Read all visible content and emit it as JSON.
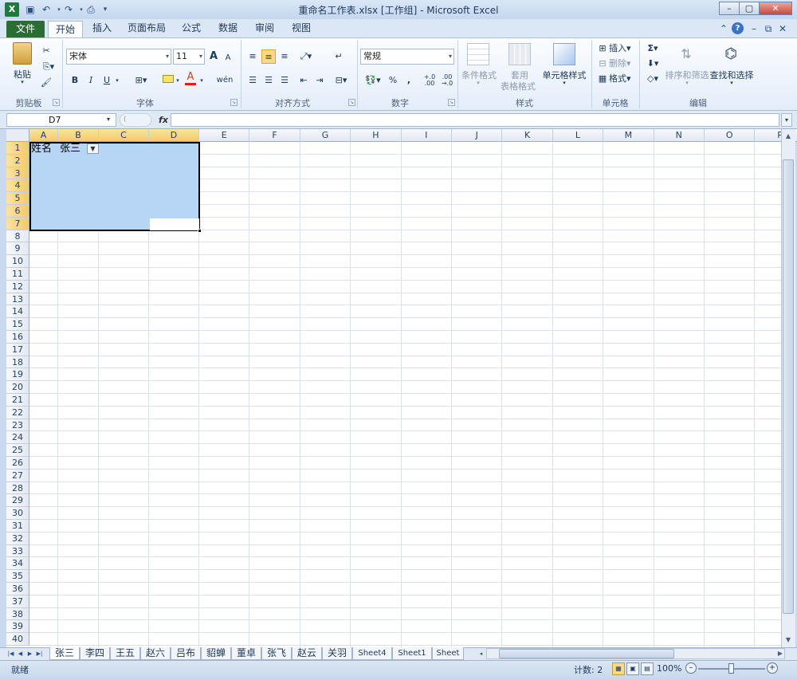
{
  "window": {
    "title": "重命名工作表.xlsx  [工作组] - Microsoft Excel",
    "app_icon": "X"
  },
  "quick_access": [
    "save-icon",
    "undo-icon",
    "redo-icon",
    "print-preview-icon",
    "customize-icon"
  ],
  "tabs": [
    {
      "label": "文件"
    },
    {
      "label": "开始"
    },
    {
      "label": "插入"
    },
    {
      "label": "页面布局"
    },
    {
      "label": "公式"
    },
    {
      "label": "数据"
    },
    {
      "label": "审阅"
    },
    {
      "label": "视图"
    }
  ],
  "ribbon": {
    "clipboard": {
      "group_label": "剪贴板",
      "paste": "粘贴"
    },
    "font": {
      "group_label": "字体",
      "font_name": "宋体",
      "font_size": "11",
      "bold": "B",
      "italic": "I",
      "underline": "U",
      "grow": "A",
      "shrink": "A",
      "font_color": "A",
      "phonetic": "wén"
    },
    "alignment": {
      "group_label": "对齐方式"
    },
    "number": {
      "group_label": "数字",
      "format": "常规",
      "percent": "%",
      "comma": ",",
      "inc_decimal": "+.0 .00",
      "dec_decimal": ".00 →.0"
    },
    "styles": {
      "group_label": "样式",
      "conditional": "条件格式",
      "table_format_1": "套用",
      "table_format_2": "表格格式",
      "cell_styles": "单元格样式"
    },
    "cells": {
      "group_label": "单元格",
      "insert": "插入",
      "delete": "删除",
      "format": "格式"
    },
    "editing": {
      "group_label": "编辑",
      "sigma": "Σ",
      "sort_filter": "排序和筛选",
      "find_select": "查找和选择"
    }
  },
  "formula_bar": {
    "name_box": "D7",
    "fx": "fx",
    "formula": ""
  },
  "columns": [
    "A",
    "B",
    "C",
    "D",
    "E",
    "F",
    "G",
    "H",
    "I",
    "J",
    "K",
    "L",
    "M",
    "N",
    "O",
    "P"
  ],
  "selected_columns": [
    "A",
    "B",
    "C",
    "D"
  ],
  "rows": [
    "1",
    "2",
    "3",
    "4",
    "5",
    "6",
    "7",
    "8",
    "9",
    "10",
    "11",
    "12",
    "13",
    "14",
    "15",
    "16",
    "17",
    "18",
    "19",
    "20",
    "21",
    "22",
    "23",
    "24",
    "25",
    "26",
    "27",
    "28",
    "29",
    "30",
    "31",
    "32",
    "33",
    "34",
    "35",
    "36",
    "37",
    "38",
    "39",
    "40"
  ],
  "selected_rows": [
    "1",
    "2",
    "3",
    "4",
    "5",
    "6",
    "7"
  ],
  "cells": {
    "A1": "姓名",
    "B1": "张三"
  },
  "sheet_tabs": [
    {
      "label": "张三",
      "active": true
    },
    {
      "label": "李四"
    },
    {
      "label": "王五"
    },
    {
      "label": "赵六"
    },
    {
      "label": "吕布"
    },
    {
      "label": "貂蝉"
    },
    {
      "label": "董卓"
    },
    {
      "label": "张飞"
    },
    {
      "label": "赵云"
    },
    {
      "label": "关羽"
    },
    {
      "label": "Sheet4"
    },
    {
      "label": "Sheet1"
    },
    {
      "label": "Sheet"
    }
  ],
  "status": {
    "mode": "就绪",
    "count": "计数: 2",
    "zoom": "100%"
  },
  "colors": {
    "accent": "#f5c96a",
    "selection": "#b7d6f5",
    "file_tab": "#2a6e36"
  }
}
